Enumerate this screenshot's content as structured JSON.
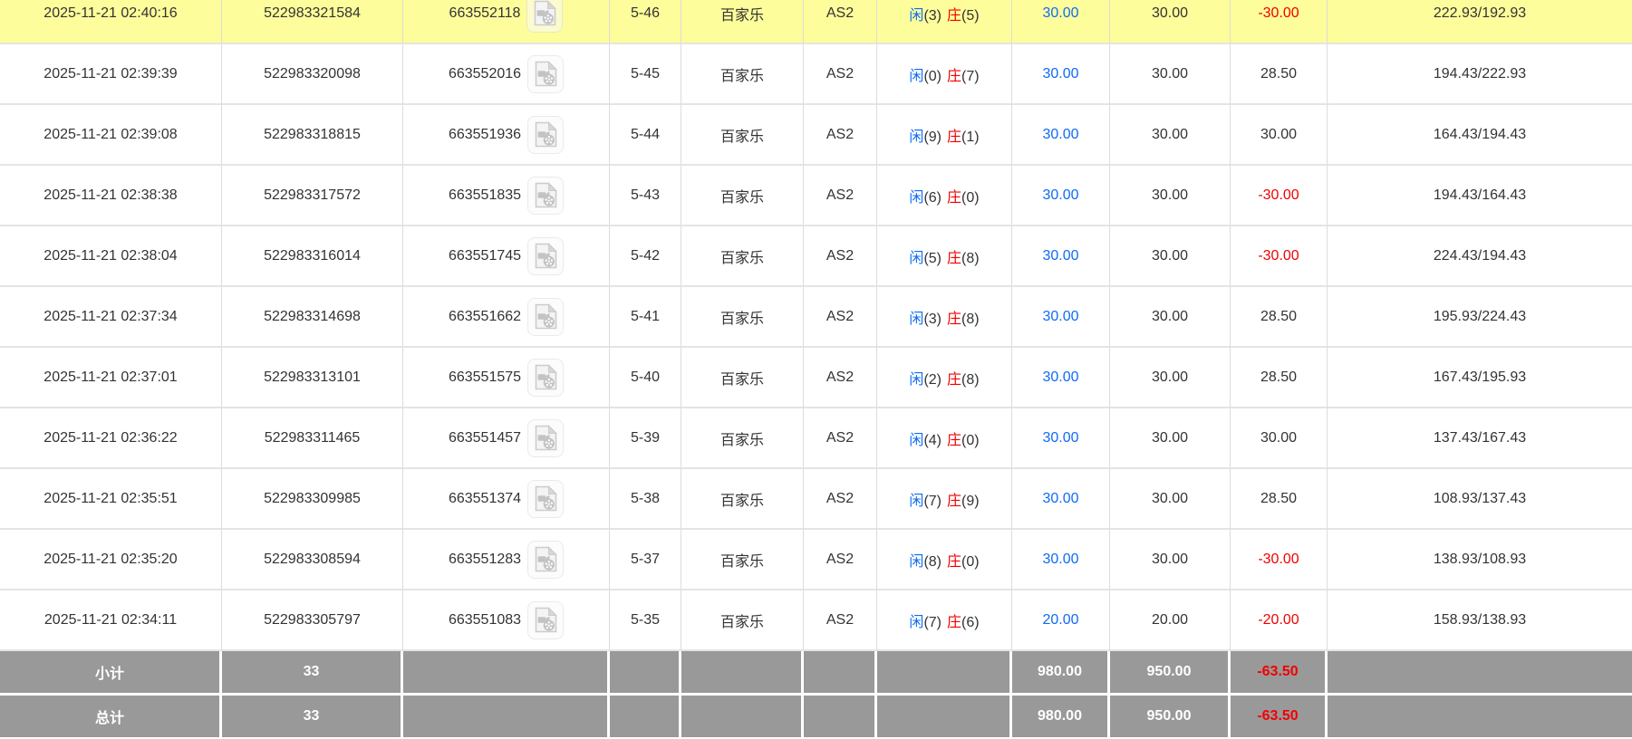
{
  "colors": {
    "highlight_row": "#fdfd9b",
    "summary_row_bg": "#999999",
    "bet_amount_blue": "#0d6bf5",
    "negative_red": "#f20000",
    "text": "#333333",
    "row_border": "#e4e4e4"
  },
  "table": {
    "labels": {
      "player": "闲",
      "banker": "庄",
      "game": "百家乐"
    },
    "icons": {
      "video_icon": "video-file-icon"
    },
    "rows": [
      {
        "time": "2025-11-21 02:40:16",
        "order_id": "522983321584",
        "round_id": "663552118",
        "round": "5-46",
        "game": "百家乐",
        "table": "AS2",
        "player_points": 3,
        "banker_points": 5,
        "bet_amount": "30.00",
        "valid_amount": "30.00",
        "win_loss": "-30.00",
        "balance": "222.93/192.93",
        "highlighted": true
      },
      {
        "time": "2025-11-21 02:39:39",
        "order_id": "522983320098",
        "round_id": "663552016",
        "round": "5-45",
        "game": "百家乐",
        "table": "AS2",
        "player_points": 0,
        "banker_points": 7,
        "bet_amount": "30.00",
        "valid_amount": "30.00",
        "win_loss": "28.50",
        "balance": "194.43/222.93",
        "highlighted": false
      },
      {
        "time": "2025-11-21 02:39:08",
        "order_id": "522983318815",
        "round_id": "663551936",
        "round": "5-44",
        "game": "百家乐",
        "table": "AS2",
        "player_points": 9,
        "banker_points": 1,
        "bet_amount": "30.00",
        "valid_amount": "30.00",
        "win_loss": "30.00",
        "balance": "164.43/194.43",
        "highlighted": false
      },
      {
        "time": "2025-11-21 02:38:38",
        "order_id": "522983317572",
        "round_id": "663551835",
        "round": "5-43",
        "game": "百家乐",
        "table": "AS2",
        "player_points": 6,
        "banker_points": 0,
        "bet_amount": "30.00",
        "valid_amount": "30.00",
        "win_loss": "-30.00",
        "balance": "194.43/164.43",
        "highlighted": false
      },
      {
        "time": "2025-11-21 02:38:04",
        "order_id": "522983316014",
        "round_id": "663551745",
        "round": "5-42",
        "game": "百家乐",
        "table": "AS2",
        "player_points": 5,
        "banker_points": 8,
        "bet_amount": "30.00",
        "valid_amount": "30.00",
        "win_loss": "-30.00",
        "balance": "224.43/194.43",
        "highlighted": false
      },
      {
        "time": "2025-11-21 02:37:34",
        "order_id": "522983314698",
        "round_id": "663551662",
        "round": "5-41",
        "game": "百家乐",
        "table": "AS2",
        "player_points": 3,
        "banker_points": 8,
        "bet_amount": "30.00",
        "valid_amount": "30.00",
        "win_loss": "28.50",
        "balance": "195.93/224.43",
        "highlighted": false
      },
      {
        "time": "2025-11-21 02:37:01",
        "order_id": "522983313101",
        "round_id": "663551575",
        "round": "5-40",
        "game": "百家乐",
        "table": "AS2",
        "player_points": 2,
        "banker_points": 8,
        "bet_amount": "30.00",
        "valid_amount": "30.00",
        "win_loss": "28.50",
        "balance": "167.43/195.93",
        "highlighted": false
      },
      {
        "time": "2025-11-21 02:36:22",
        "order_id": "522983311465",
        "round_id": "663551457",
        "round": "5-39",
        "game": "百家乐",
        "table": "AS2",
        "player_points": 4,
        "banker_points": 0,
        "bet_amount": "30.00",
        "valid_amount": "30.00",
        "win_loss": "30.00",
        "balance": "137.43/167.43",
        "highlighted": false
      },
      {
        "time": "2025-11-21 02:35:51",
        "order_id": "522983309985",
        "round_id": "663551374",
        "round": "5-38",
        "game": "百家乐",
        "table": "AS2",
        "player_points": 7,
        "banker_points": 9,
        "bet_amount": "30.00",
        "valid_amount": "30.00",
        "win_loss": "28.50",
        "balance": "108.93/137.43",
        "highlighted": false
      },
      {
        "time": "2025-11-21 02:35:20",
        "order_id": "522983308594",
        "round_id": "663551283",
        "round": "5-37",
        "game": "百家乐",
        "table": "AS2",
        "player_points": 8,
        "banker_points": 0,
        "bet_amount": "30.00",
        "valid_amount": "30.00",
        "win_loss": "-30.00",
        "balance": "138.93/108.93",
        "highlighted": false
      },
      {
        "time": "2025-11-21 02:34:11",
        "order_id": "522983305797",
        "round_id": "663551083",
        "round": "5-35",
        "game": "百家乐",
        "table": "AS2",
        "player_points": 7,
        "banker_points": 6,
        "bet_amount": "20.00",
        "valid_amount": "20.00",
        "win_loss": "-20.00",
        "balance": "158.93/138.93",
        "highlighted": false
      }
    ],
    "subtotal": {
      "label": "小计",
      "count": "33",
      "bet_total": "980.00",
      "valid_total": "950.00",
      "win_loss_total": "-63.50"
    },
    "total": {
      "label": "总计",
      "count": "33",
      "bet_total": "980.00",
      "valid_total": "950.00",
      "win_loss_total": "-63.50"
    }
  }
}
